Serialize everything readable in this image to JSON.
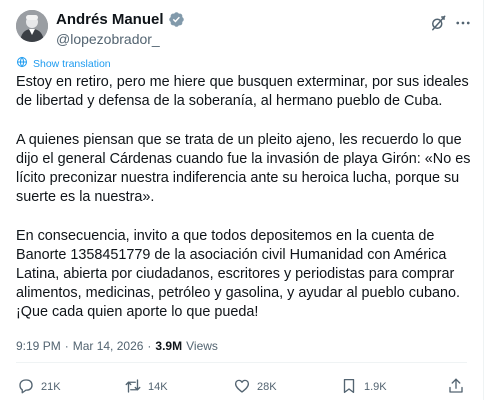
{
  "author": {
    "display_name": "Andrés Manuel",
    "handle": "@lopezobrador_",
    "verified": true
  },
  "translate_label": "Show translation",
  "paragraphs": [
    "Estoy en retiro, pero me hiere que busquen exterminar, por sus ideales de libertad y defensa de la soberanía, al hermano pueblo de Cuba.",
    "A quienes piensan que se trata de un pleito ajeno, les recuerdo lo que dijo el general Cárdenas cuando fue la invasión de playa Girón: «No es lícito preconizar nuestra indiferencia ante su heroica lucha, porque su suerte es la nuestra».",
    "En consecuencia, invito a que todos depositemos en la cuenta de Banorte 1358451779 de la asociación civil Humanidad con América Latina, abierta por ciudadanos, escritores y periodistas para comprar alimentos, medicinas, petróleo y gasolina, y ayudar al pueblo cubano. ¡Que cada quien aporte lo que pueda!"
  ],
  "meta": {
    "time": "9:19 PM",
    "separator": "·",
    "date": "Mar 14, 2026",
    "views_count": "3.9M",
    "views_label": "Views"
  },
  "actions": {
    "replies": "21K",
    "reposts": "14K",
    "likes": "28K",
    "bookmarks": "1.9K"
  },
  "colors": {
    "text": "#0f1419",
    "secondary": "#536471",
    "accent": "#1d9bf0",
    "divider": "#eff3f4"
  },
  "icons": [
    "verified-badge-icon",
    "grok-icon",
    "more-icon",
    "globe-icon",
    "reply-icon",
    "repost-icon",
    "like-icon",
    "bookmark-icon",
    "share-icon"
  ]
}
